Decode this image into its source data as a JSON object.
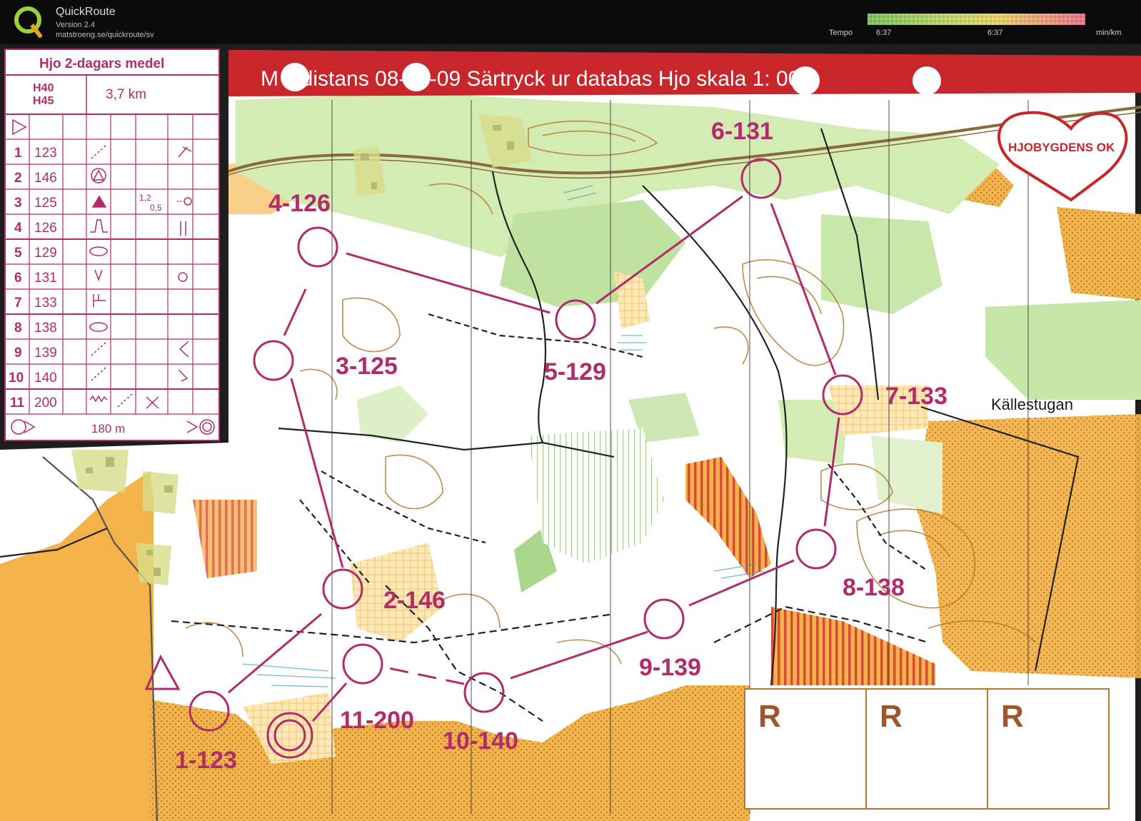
{
  "app": {
    "title": "QuickRoute",
    "version": "Version 2.4",
    "url": "matstroeng.se/quickroute/sv"
  },
  "tempo": {
    "label": "Tempo",
    "value_left": "6:37",
    "value_mid": "6:37",
    "unit": "min/km"
  },
  "map": {
    "header": "M  eldistans  08-08-09 Särtryck ur databas Hjo   skala 1:   000",
    "club_logo": "HJOBYGDENS OK",
    "place_name": "Källestugan",
    "controls": [
      {
        "label": "1-123"
      },
      {
        "label": "2-146"
      },
      {
        "label": "3-125"
      },
      {
        "label": "4-126"
      },
      {
        "label": "5-129"
      },
      {
        "label": "6-131"
      },
      {
        "label": "7-133"
      },
      {
        "label": "8-138"
      },
      {
        "label": "9-139"
      },
      {
        "label": "10-140"
      },
      {
        "label": "11-200"
      }
    ],
    "r_boxes": [
      "R",
      "R",
      "R"
    ]
  },
  "description_sheet": {
    "title": "Hjo 2-dagars medel",
    "classes": [
      "H40",
      "H45"
    ],
    "distance": "3,7 km",
    "rows": [
      {
        "num": "1",
        "code": "123"
      },
      {
        "num": "2",
        "code": "146"
      },
      {
        "num": "3",
        "code": "125",
        "dims_top": "1,2",
        "dims_bottom": "0,5"
      },
      {
        "num": "4",
        "code": "126"
      },
      {
        "num": "5",
        "code": "129"
      },
      {
        "num": "6",
        "code": "131"
      },
      {
        "num": "7",
        "code": "133"
      },
      {
        "num": "8",
        "code": "138"
      },
      {
        "num": "9",
        "code": "139"
      },
      {
        "num": "10",
        "code": "140"
      },
      {
        "num": "11",
        "code": "200"
      }
    ],
    "finish_distance": "180 m"
  },
  "colors": {
    "overprint": "#b22b6b",
    "header_red": "#c8262a",
    "open_field": "#f4b24a",
    "forest_green": "#bfe2a0",
    "contour": "#b5792b"
  }
}
